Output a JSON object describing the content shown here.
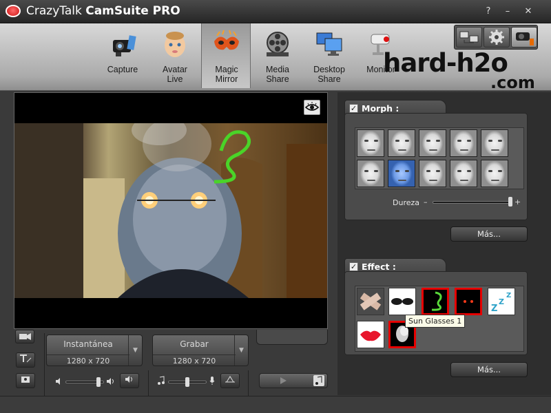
{
  "window": {
    "title_light": "CrazyTalk ",
    "title_bold": "CamSuite PRO",
    "help_label": "?",
    "minimize_label": "–",
    "close_label": "✕"
  },
  "nav": {
    "tabs": [
      {
        "line1": "Capture",
        "line2": "",
        "icon": "camera-icon"
      },
      {
        "line1": "Avatar",
        "line2": "Live",
        "icon": "baby-face-icon"
      },
      {
        "line1": "Magic",
        "line2": "Mirror",
        "icon": "mask-icon",
        "active": true
      },
      {
        "line1": "Media",
        "line2": "Share",
        "icon": "film-reel-icon"
      },
      {
        "line1": "Desktop",
        "line2": "Share",
        "icon": "monitor-icon"
      },
      {
        "line1": "Monitor",
        "line2": "",
        "icon": "security-camera-icon"
      }
    ]
  },
  "watermark": {
    "text": "hard-h2o",
    "sub": ".com"
  },
  "capture": {
    "snapshot_label": "Instantánea",
    "snapshot_resolution": "1280 x 720",
    "record_label": "Grabar",
    "record_resolution": "1280 x 720"
  },
  "morph": {
    "title": "Morph :",
    "checked": true,
    "slider_label": "Dureza",
    "slider_min_symbol": "–",
    "slider_max_symbol": "+",
    "slider_level": 0.97,
    "more_label": "Más..."
  },
  "effect": {
    "title": "Effect :",
    "checked": true,
    "tooltip": "Sun Glasses 1",
    "more_label": "Más..."
  },
  "colors": {
    "accent_red": "#e60000",
    "panel_bg": "#4b4b4b",
    "toolbar_bg": "#c4c4c4"
  }
}
